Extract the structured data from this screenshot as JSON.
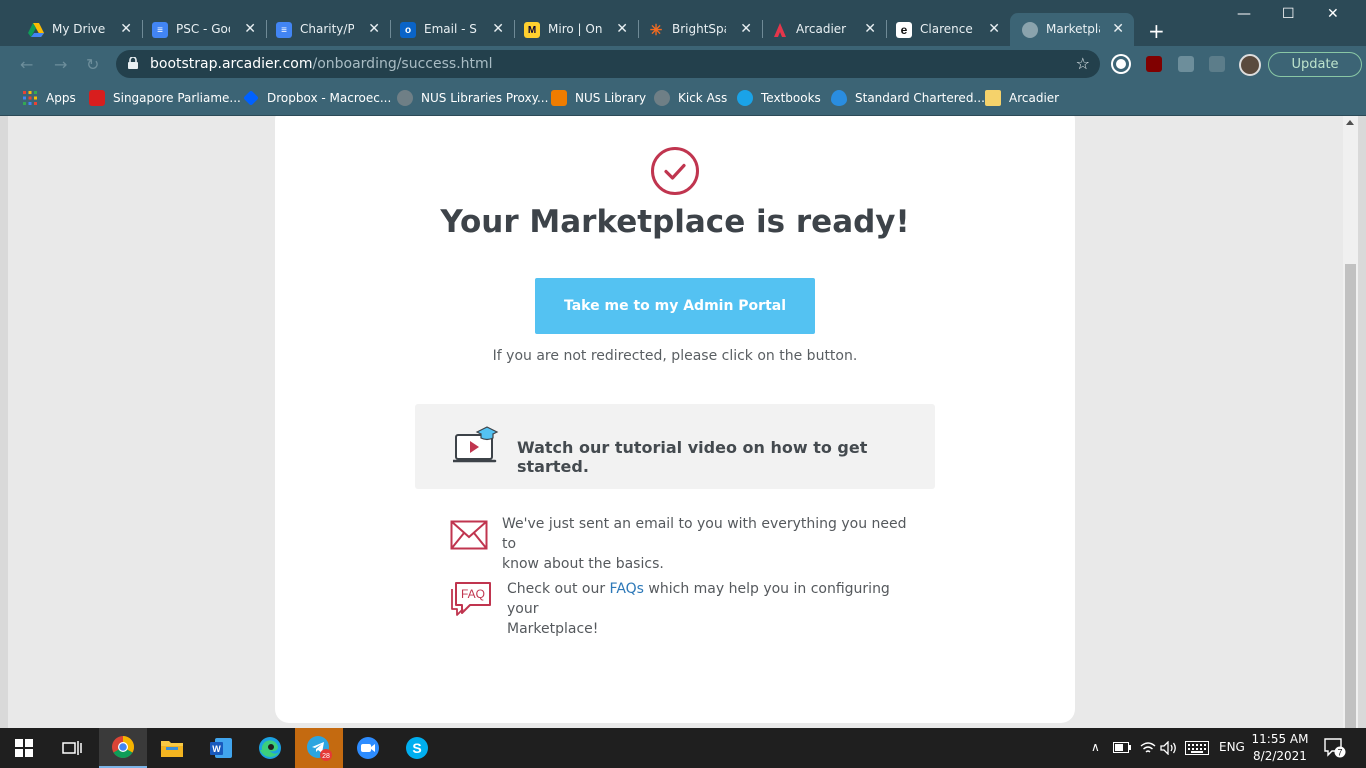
{
  "browser": {
    "tabs": [
      {
        "title": "My Drive - G",
        "icon": "google-drive-icon",
        "color": "#fbbc04"
      },
      {
        "title": "PSC - Google",
        "icon": "google-docs-icon",
        "color": "#4285f4"
      },
      {
        "title": "Charity/Phi",
        "icon": "google-docs-icon",
        "color": "#4285f4"
      },
      {
        "title": "Email - Siuf",
        "icon": "outlook-icon",
        "color": "#0a64c8"
      },
      {
        "title": "Miro | Onlin",
        "icon": "miro-icon",
        "color": "#ffd02f"
      },
      {
        "title": "BrightSpark",
        "icon": "brightspark-icon",
        "color": "#f26b21"
      },
      {
        "title": "Arcadier Su",
        "icon": "arcadier-icon",
        "color": "#e5364b"
      },
      {
        "title": "Clarence Si",
        "icon": "e-icon",
        "color": "#111111"
      },
      {
        "title": "Marketplac",
        "icon": "globe-icon",
        "color": "#8aa3ad"
      }
    ],
    "new_tab": "+",
    "window_controls": {
      "minimize": "—",
      "maximize": "☐",
      "close": "✕"
    },
    "nav": {
      "back": "←",
      "forward": "→",
      "reload": "↻"
    },
    "url_host": "bootstrap.arcadier.com",
    "url_path": "/onboarding/success.html",
    "bookmark_star": "☆",
    "update_label": "Update",
    "bookmarks": [
      {
        "label": "Apps",
        "icon": "apps-grid-icon",
        "color": "#ea4335"
      },
      {
        "label": "Singapore Parliame...",
        "icon": "parliament-icon",
        "color": "#d81e1e"
      },
      {
        "label": "Dropbox - Macroec...",
        "icon": "dropbox-icon",
        "color": "#0061ff"
      },
      {
        "label": "NUS Libraries Proxy...",
        "icon": "globe-icon",
        "color": "#6f7f86"
      },
      {
        "label": "NUS Library",
        "icon": "nus-icon",
        "color": "#ef7c00"
      },
      {
        "label": "Kick Ass",
        "icon": "globe-icon",
        "color": "#6f7f86"
      },
      {
        "label": "Textbooks",
        "icon": "textbooks-icon",
        "color": "#1aa3e8"
      },
      {
        "label": "Standard Chartered...",
        "icon": "standard-chartered-icon",
        "color": "#2a8de0"
      },
      {
        "label": "Arcadier",
        "icon": "folder-icon",
        "color": "#f5d26b"
      }
    ]
  },
  "page": {
    "title": "Your Marketplace is ready!",
    "admin_button": "Take me to my Admin Portal",
    "redirect_note": "If you are not redirected, please click on the button.",
    "tutorial": "Watch our tutorial video on how to get started.",
    "email_line1": "We've just sent an email to you with everything you need to",
    "email_line2": "know about the basics.",
    "faq_before": "Check out our ",
    "faq_link": "FAQs",
    "faq_after": " which may help you in configuring your",
    "faq_line2": "Marketplace!",
    "faq_badge": "FAQ",
    "accent_color": "#c0354f",
    "button_color": "#54c2f2"
  },
  "taskbar": {
    "language": "ENG",
    "time": "11:55 AM",
    "date": "8/2/2021",
    "telegram_badge": "28",
    "notification_count": "7",
    "tray_up": "∧"
  }
}
